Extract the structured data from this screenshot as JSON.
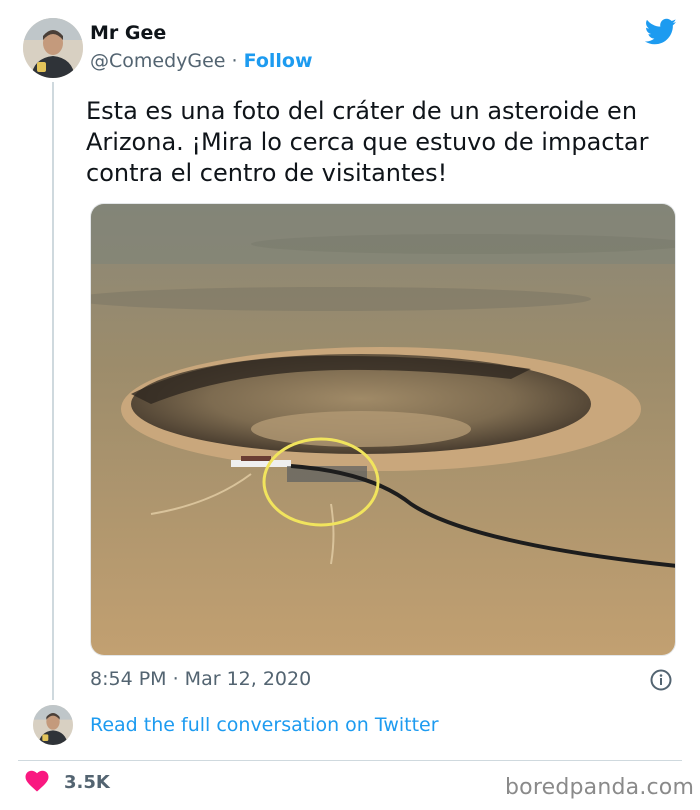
{
  "tweet": {
    "author_name": "Mr Gee",
    "handle": "@ComedyGee",
    "separator": "·",
    "follow_label": "Follow",
    "text": "Esta es una foto del cráter de un asteroide en Arizona. ¡Mira lo cerca que estuvo de impactar contra el centro de visitantes!",
    "timestamp": "8:54 PM · Mar 12, 2020",
    "read_link": "Read the full conversation on Twitter",
    "likes": "3.5K",
    "accent_color": "#1d9bf0",
    "heart_color": "#f91880"
  },
  "icons": {
    "brand": "twitter-bird-icon",
    "info": "info-icon",
    "like": "heart-icon"
  },
  "watermark": "boredpanda.com"
}
